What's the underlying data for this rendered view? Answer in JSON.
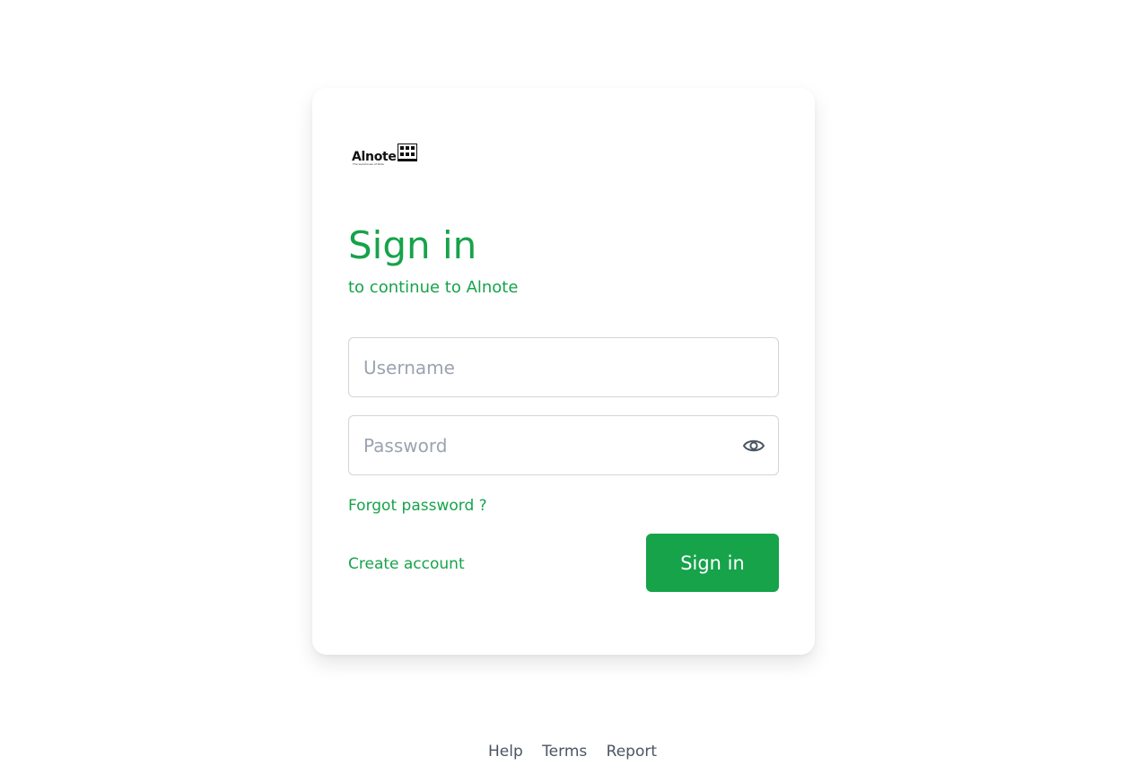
{
  "brand": {
    "logo_text": "Alnote",
    "logo_tagline": "The warehouse of Note",
    "accent_color": "#16a34a"
  },
  "card": {
    "title": "Sign in",
    "subtitle": "to continue to Alnote"
  },
  "form": {
    "username": {
      "value": "",
      "placeholder": "Username"
    },
    "password": {
      "value": "",
      "placeholder": "Password",
      "toggle_icon": "eye-icon"
    },
    "forgot_label": "Forgot password ?",
    "create_label": "Create account",
    "submit_label": "Sign in"
  },
  "footer": {
    "links": [
      "Help",
      "Terms",
      "Report"
    ]
  }
}
